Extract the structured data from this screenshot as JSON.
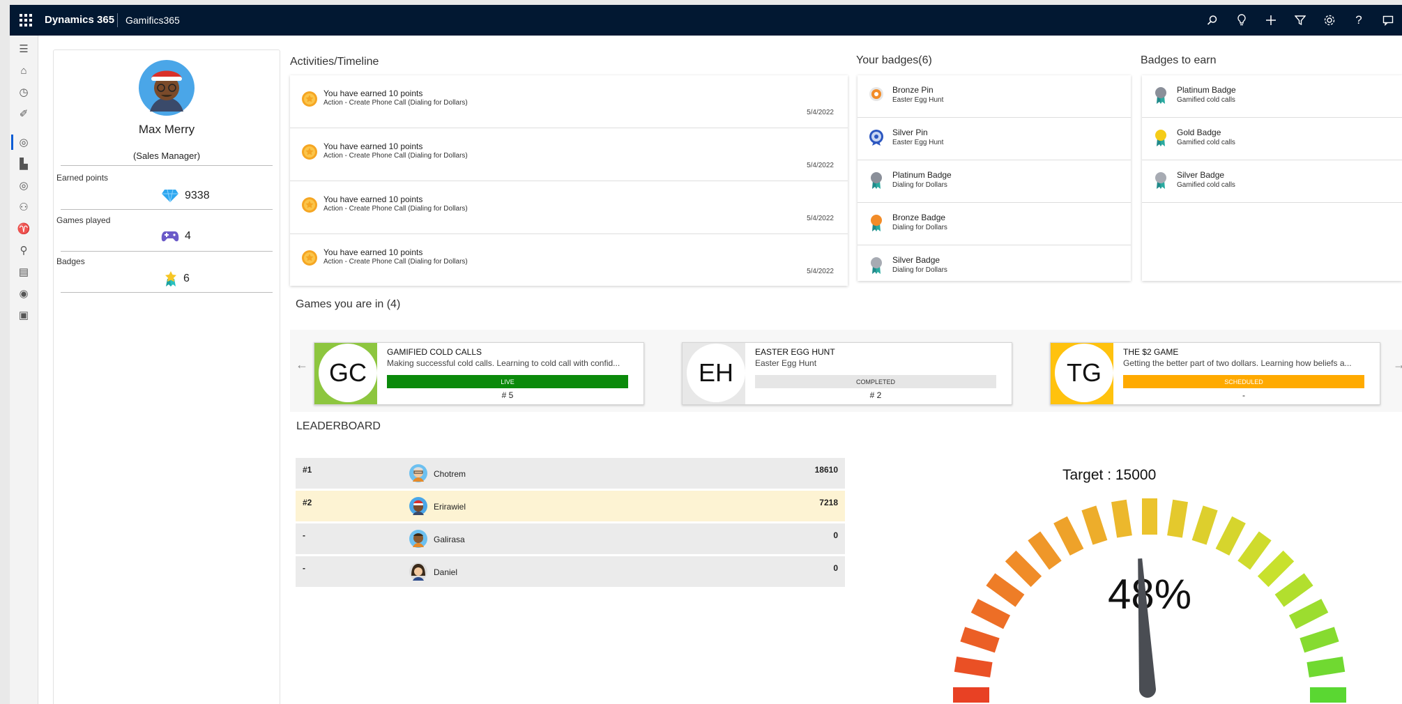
{
  "topbar": {
    "app_name": "Dynamics 365",
    "app_sub": "Gamifics365",
    "icons": [
      "search-icon",
      "lightbulb-icon",
      "plus-icon",
      "filter-icon",
      "gear-icon",
      "help-icon",
      "chat-icon"
    ]
  },
  "leftnav": {
    "icons": [
      "hamburger-icon",
      "home-icon",
      "recent-icon",
      "pin-icon",
      "target-icon",
      "leaderboard-icon",
      "target-icon",
      "bike-icon",
      "trophy-icon",
      "person-icon",
      "report-icon",
      "gauge-icon",
      "badge-list-icon"
    ]
  },
  "profile": {
    "name": "Max Merry",
    "role": "(Sales Manager)",
    "earned_label": "Earned points",
    "earned_value": "9338",
    "games_label": "Games played",
    "games_value": "4",
    "badges_label": "Badges",
    "badges_value": "6"
  },
  "timeline": {
    "title": "Activities/Timeline",
    "items": [
      {
        "title": "You have earned 10 points",
        "sub": "Action - Create Phone Call (Dialing for Dollars)",
        "date": "5/4/2022"
      },
      {
        "title": "You have earned 10 points",
        "sub": "Action - Create Phone Call (Dialing for Dollars)",
        "date": "5/4/2022"
      },
      {
        "title": "You have earned 10 points",
        "sub": "Action - Create Phone Call (Dialing for Dollars)",
        "date": "5/4/2022"
      },
      {
        "title": "You have earned 10 points",
        "sub": "Action - Create Phone Call (Dialing for Dollars)",
        "date": "5/4/2022"
      }
    ]
  },
  "your_badges": {
    "title": "Your badges(6)",
    "items": [
      {
        "name": "Bronze Pin",
        "game": "Easter Egg Hunt"
      },
      {
        "name": "Silver Pin",
        "game": "Easter Egg Hunt"
      },
      {
        "name": "Platinum Badge",
        "game": "Dialing for Dollars"
      },
      {
        "name": "Bronze Badge",
        "game": "Dialing for Dollars"
      },
      {
        "name": "Silver Badge",
        "game": "Dialing for Dollars"
      }
    ]
  },
  "badges_to_earn": {
    "title": "Badges to earn",
    "items": [
      {
        "name": "Platinum Badge",
        "game": "Gamified cold calls"
      },
      {
        "name": "Gold Badge",
        "game": "Gamified cold calls"
      },
      {
        "name": "Silver Badge",
        "game": "Gamified cold calls"
      }
    ]
  },
  "games": {
    "title": "Games you are in (4)",
    "prev_arrow": "←",
    "next_arrow": "→",
    "cards": [
      {
        "initials": "GC",
        "name": "GAMIFIED COLD CALLS",
        "desc": "Making successful cold calls. Learning to cold call with confid...",
        "status": "LIVE",
        "rank": "# 5",
        "color": "#8dc63f",
        "status_color": "#0b8a0b"
      },
      {
        "initials": "EH",
        "name": "EASTER EGG HUNT",
        "desc": "Easter Egg Hunt",
        "status": "COMPLETED",
        "rank": "# 2",
        "color": "#e8e8e8",
        "status_color": "#e6e6e6"
      },
      {
        "initials": "TG",
        "name": "THE $2 GAME",
        "desc": "Getting the better part of two dollars. Learning how beliefs a...",
        "status": "SCHEDULED",
        "rank": "-",
        "color": "#ffc20e",
        "status_color": "#ffaa00"
      }
    ]
  },
  "leaderboard": {
    "title": "LEADERBOARD",
    "rows": [
      {
        "rank": "#1",
        "name": "Chotrem",
        "points": "18610"
      },
      {
        "rank": "#2",
        "name": "Erirawiel",
        "points": "7218"
      },
      {
        "rank": "-",
        "name": "Galirasa",
        "points": "0"
      },
      {
        "rank": "-",
        "name": "Daniel",
        "points": "0"
      }
    ]
  },
  "gauge": {
    "target_label": "Target : 15000",
    "percent": 48,
    "percent_label": "48%"
  }
}
